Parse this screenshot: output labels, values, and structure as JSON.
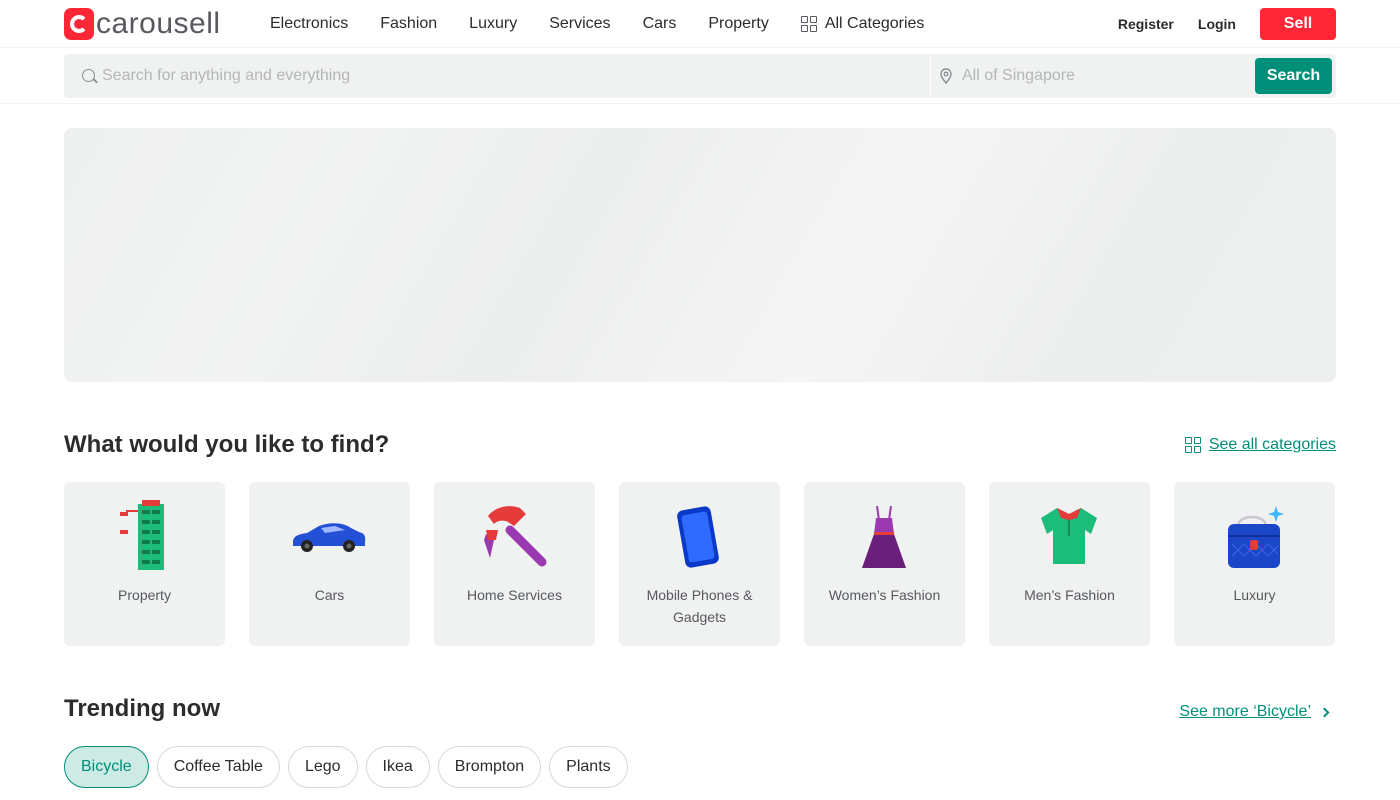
{
  "brand": {
    "name": "carousell",
    "color": "#ff2636"
  },
  "nav": {
    "items": [
      "Electronics",
      "Fashion",
      "Luxury",
      "Services",
      "Cars",
      "Property"
    ],
    "all_categories": "All Categories",
    "register": "Register",
    "login": "Login",
    "sell": "Sell"
  },
  "search": {
    "placeholder": "Search for anything and everything",
    "location_placeholder": "All of Singapore",
    "button": "Search",
    "accent": "#008f79"
  },
  "categories": {
    "title": "What would you like to find?",
    "see_all": "See all categories",
    "items": [
      {
        "label": "Property",
        "icon": "building-icon"
      },
      {
        "label": "Cars",
        "icon": "car-icon"
      },
      {
        "label": "Home Services",
        "icon": "hammer-icon"
      },
      {
        "label": "Mobile Phones & Gadgets",
        "icon": "phone-icon"
      },
      {
        "label": "Women’s Fashion",
        "icon": "dress-icon"
      },
      {
        "label": "Men’s Fashion",
        "icon": "shirt-icon"
      },
      {
        "label": "Luxury",
        "icon": "handbag-icon"
      }
    ]
  },
  "trending": {
    "title": "Trending now",
    "see_more": "See more ‘Bicycle’",
    "chips": [
      "Bicycle",
      "Coffee Table",
      "Lego",
      "Ikea",
      "Brompton",
      "Plants"
    ],
    "active_chip": "Bicycle"
  }
}
